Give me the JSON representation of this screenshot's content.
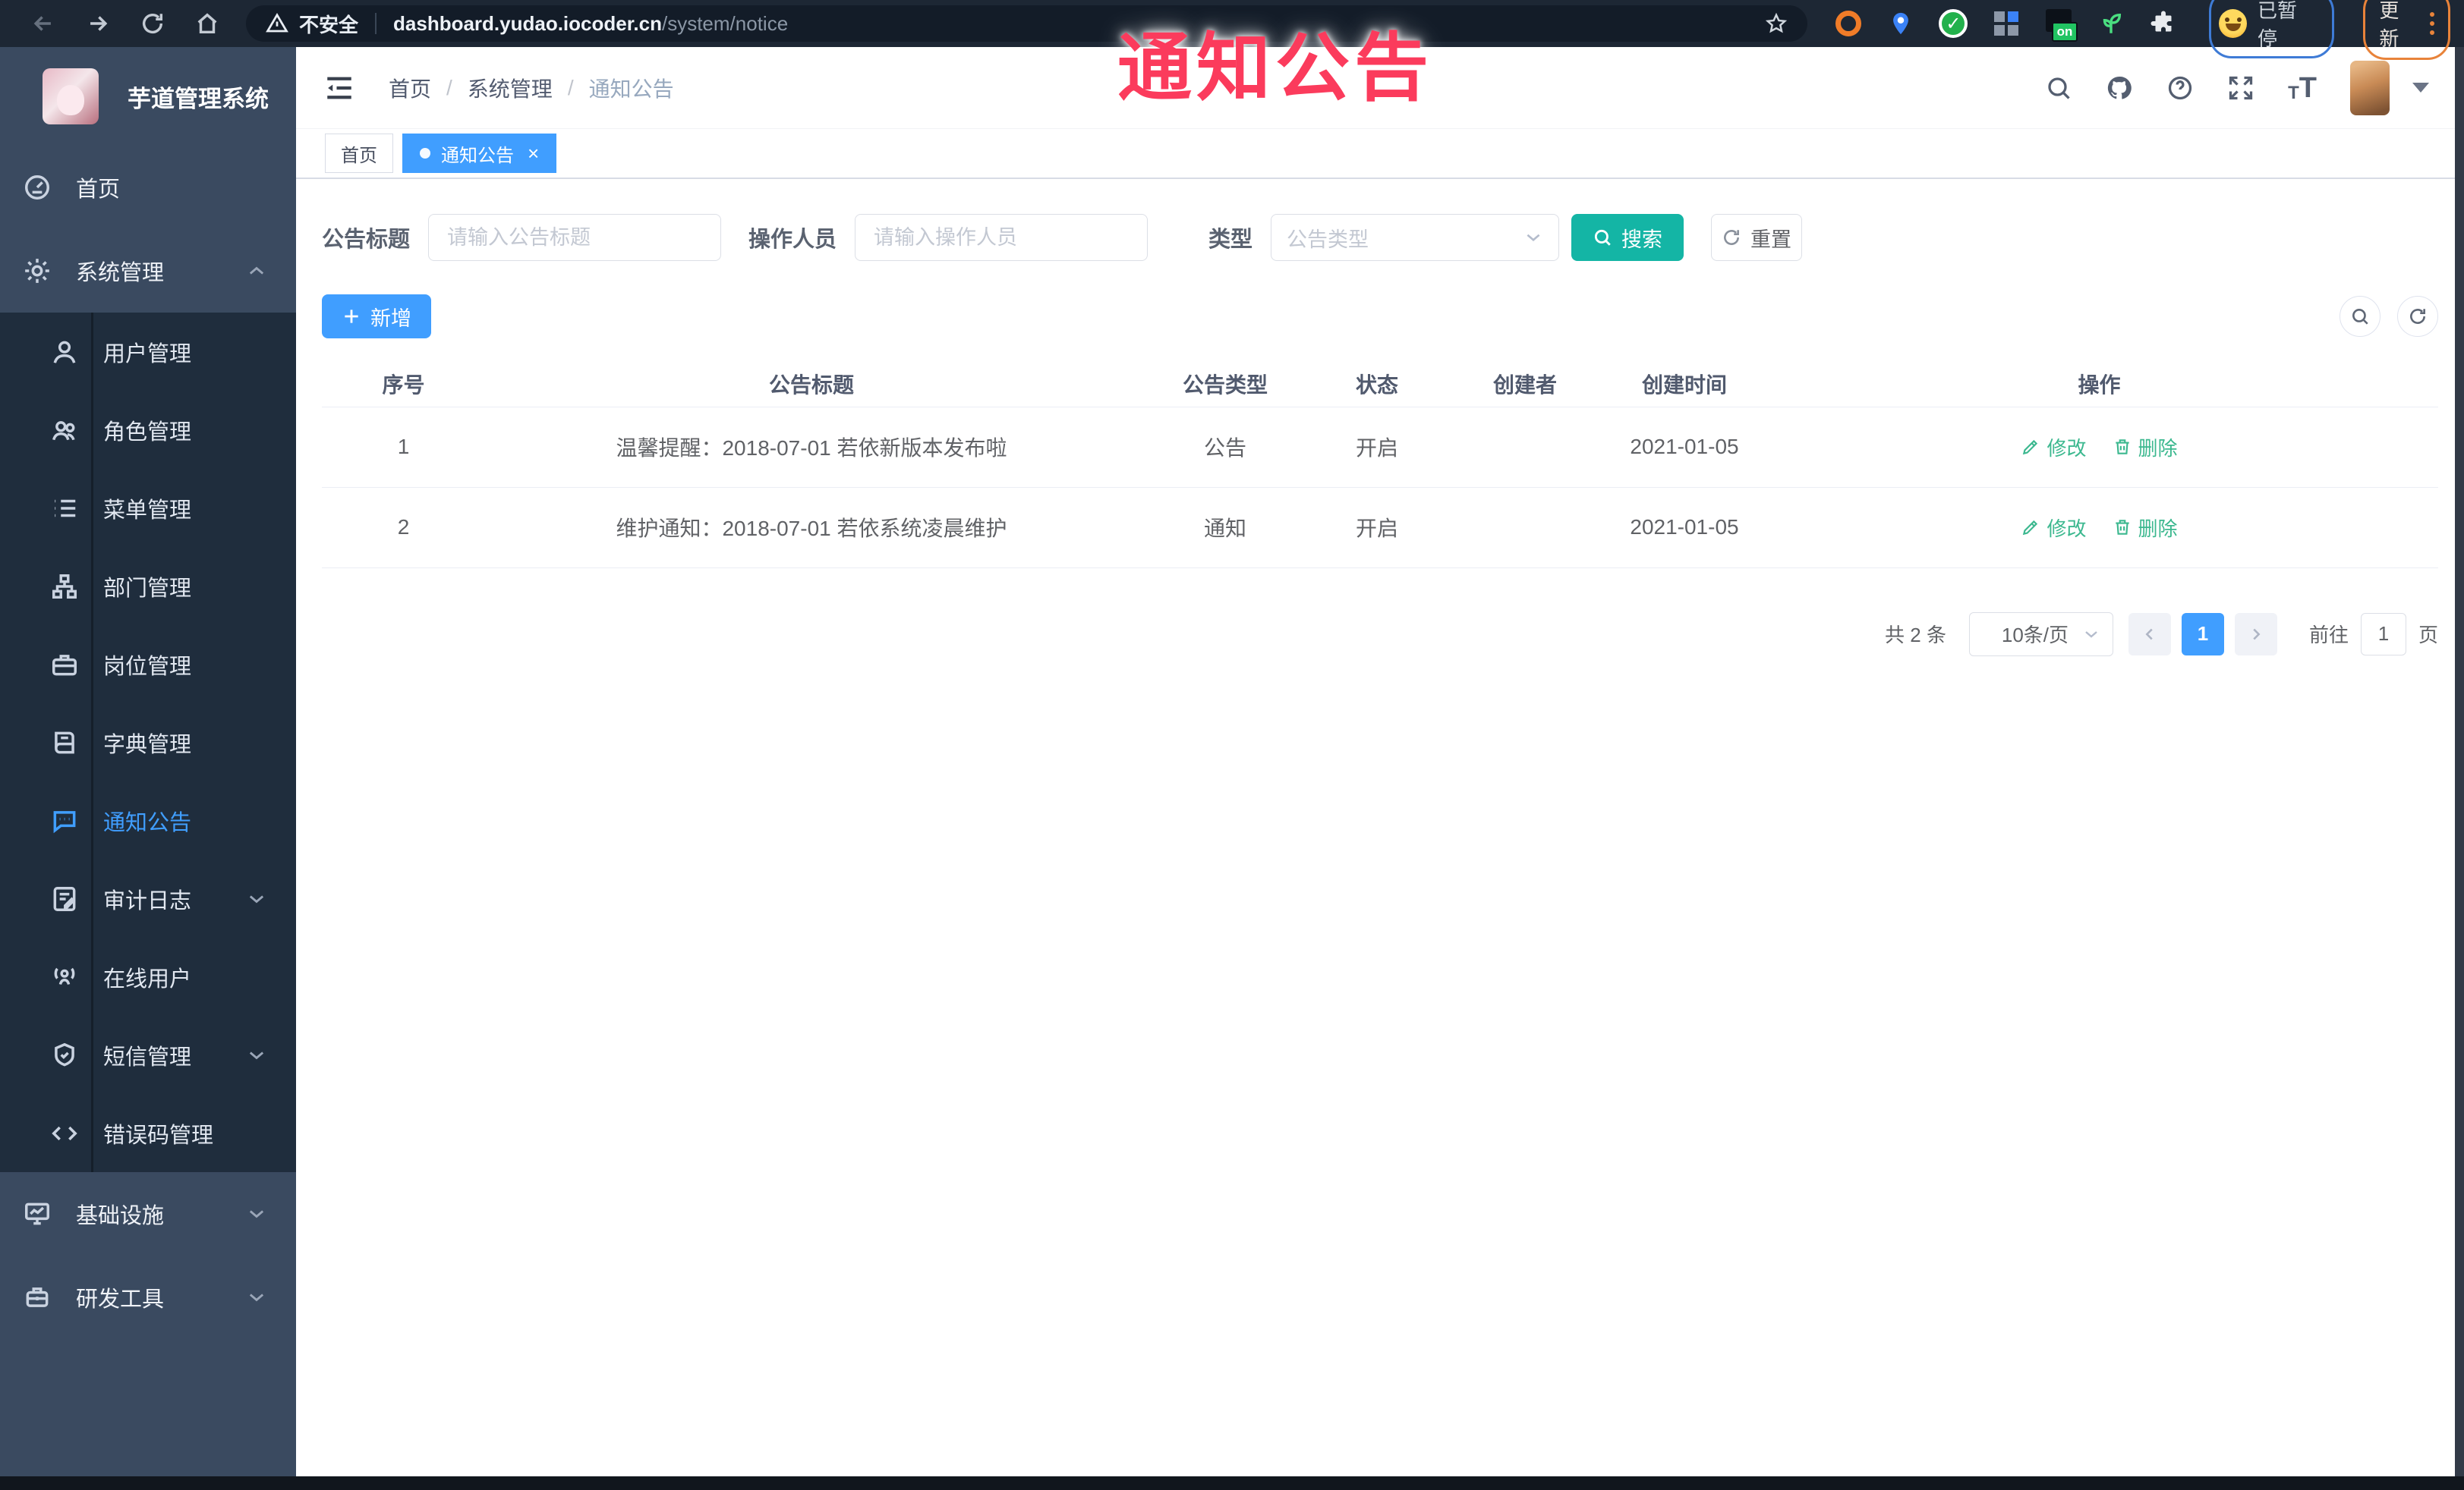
{
  "browser": {
    "security_label": "不安全",
    "url_domain": "dashboard.yudao.iocoder.cn",
    "url_path": "/system/notice",
    "paused_badge_label": "已暂停",
    "update_button_label": "更新",
    "extension_on_badge": "on"
  },
  "overlay_title": "通知公告",
  "sidebar": {
    "app_title": "芋道管理系统",
    "items": [
      {
        "label": "首页"
      },
      {
        "label": "系统管理"
      },
      {
        "label": "用户管理"
      },
      {
        "label": "角色管理"
      },
      {
        "label": "菜单管理"
      },
      {
        "label": "部门管理"
      },
      {
        "label": "岗位管理"
      },
      {
        "label": "字典管理"
      },
      {
        "label": "通知公告"
      },
      {
        "label": "审计日志"
      },
      {
        "label": "在线用户"
      },
      {
        "label": "短信管理"
      },
      {
        "label": "错误码管理"
      },
      {
        "label": "基础设施"
      },
      {
        "label": "研发工具"
      }
    ]
  },
  "breadcrumb": {
    "items": [
      "首页",
      "系统管理",
      "通知公告"
    ],
    "separator": "/"
  },
  "tabs": [
    {
      "label": "首页"
    },
    {
      "label": "通知公告",
      "close": "×"
    }
  ],
  "filters": {
    "title_label": "公告标题",
    "title_placeholder": "请输入公告标题",
    "operator_label": "操作人员",
    "operator_placeholder": "请输入操作人员",
    "type_label": "类型",
    "type_placeholder": "公告类型",
    "search_label": "搜索",
    "reset_label": "重置"
  },
  "toolbar": {
    "add_label": "新增"
  },
  "table": {
    "columns": [
      "序号",
      "公告标题",
      "公告类型",
      "状态",
      "创建者",
      "创建时间",
      "操作"
    ],
    "rows": [
      {
        "no": "1",
        "title": "温馨提醒：2018-07-01 若依新版本发布啦",
        "type": "公告",
        "status": "开启",
        "creator": "",
        "created": "2021-01-05",
        "edit_label": "修改",
        "delete_label": "删除"
      },
      {
        "no": "2",
        "title": "维护通知：2018-07-01 若依系统凌晨维护",
        "type": "通知",
        "status": "开启",
        "creator": "",
        "created": "2021-01-05",
        "edit_label": "修改",
        "delete_label": "删除"
      }
    ]
  },
  "pagination": {
    "total_label": "共 2 条",
    "page_size_label": "10条/页",
    "current_page": "1",
    "goto_label": "前往",
    "goto_value": "1",
    "unit_label": "页"
  },
  "colors": {
    "accent_blue": "#409EFF",
    "search_teal": "#14b5a5",
    "action_green": "#3cb88f",
    "overlay_red": "#fb3b5c",
    "sidebar_bg": "#3a4a60",
    "submenu_bg": "#1f2d3d"
  }
}
